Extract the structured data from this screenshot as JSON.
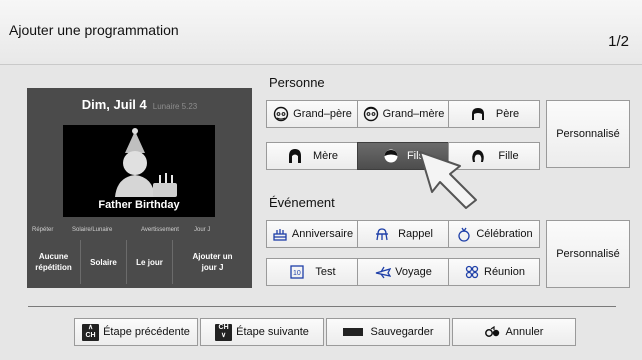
{
  "header": {
    "title": "Ajouter une programmation",
    "page_indicator": "1/2"
  },
  "preview": {
    "date": "Dim, Juil 4",
    "lunar": "Lunaire 5.23",
    "picture_label": "Father Birthday",
    "option_headers": [
      "Répéter",
      "Solaire/Lunaire",
      "Avertissement",
      "Jour J"
    ],
    "options": [
      "Aucune répétition",
      "Solaire",
      "Le jour",
      "Ajouter un jour J"
    ]
  },
  "person": {
    "heading": "Personne",
    "buttons": [
      "Grand–père",
      "Grand–mère",
      "Père",
      "Mère",
      "Fils",
      "Fille"
    ],
    "custom": "Personnalisé",
    "selected": "Fils",
    "icons": [
      "grandfather-icon",
      "grandmother-icon",
      "father-icon",
      "mother-icon",
      "son-icon",
      "daughter-icon"
    ]
  },
  "event": {
    "heading": "Événement",
    "buttons": [
      "Anniversaire",
      "Rappel",
      "Célébration",
      "Test",
      "Voyage",
      "Réunion"
    ],
    "custom": "Personnalisé",
    "icons": [
      "birthday-cake-icon",
      "memorial-icon",
      "celebration-icon",
      "test-icon",
      "travel-icon",
      "meeting-icon"
    ]
  },
  "nav": {
    "prev": "Étape précédente",
    "next": "Étape suivante",
    "save": "Sauvegarder",
    "cancel": "Annuler",
    "key_letters": "CH"
  },
  "colors": {
    "selected_bg": "#5a5a5a",
    "panel_bg": "#4b4b4b",
    "screen_bg": "#e6e6e6"
  }
}
